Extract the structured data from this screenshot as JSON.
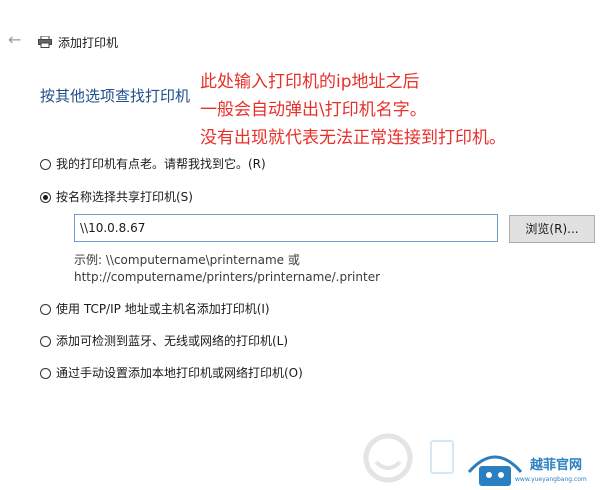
{
  "window": {
    "title": "添加打印机"
  },
  "icons": {
    "back": "arrow-left-icon",
    "printer": "printer-icon",
    "watermark": "smile-logo-icon"
  },
  "section_heading": "按其他选项查找打印机",
  "annotation": {
    "color": "#e8302b",
    "lines": [
      "此处输入打印机的ip地址之后",
      "一般会自动弹出\\打印机名字。",
      "没有出现就代表无法正常连接到打印机。"
    ]
  },
  "options": [
    {
      "label": "我的打印机有点老。请帮我找到它。(R)",
      "checked": false
    },
    {
      "label": "按名称选择共享打印机(S)",
      "checked": true
    },
    {
      "label": "使用 TCP/IP 地址或主机名添加打印机(I)",
      "checked": false
    },
    {
      "label": "添加可检测到蓝牙、无线或网络的打印机(L)",
      "checked": false
    },
    {
      "label": "通过手动设置添加本地打印机或网络打印机(O)",
      "checked": false
    }
  ],
  "shared_printer_input": {
    "value": "\\\\10.0.8.67"
  },
  "browse_button": {
    "label": "浏览(R)..."
  },
  "example": {
    "line1": "示例: \\\\computername\\printername 或",
    "line2": "http://computername/printers/printername/.printer"
  },
  "watermark": {
    "brand": "越菲官网",
    "url": "www.yueyangbang.com"
  }
}
